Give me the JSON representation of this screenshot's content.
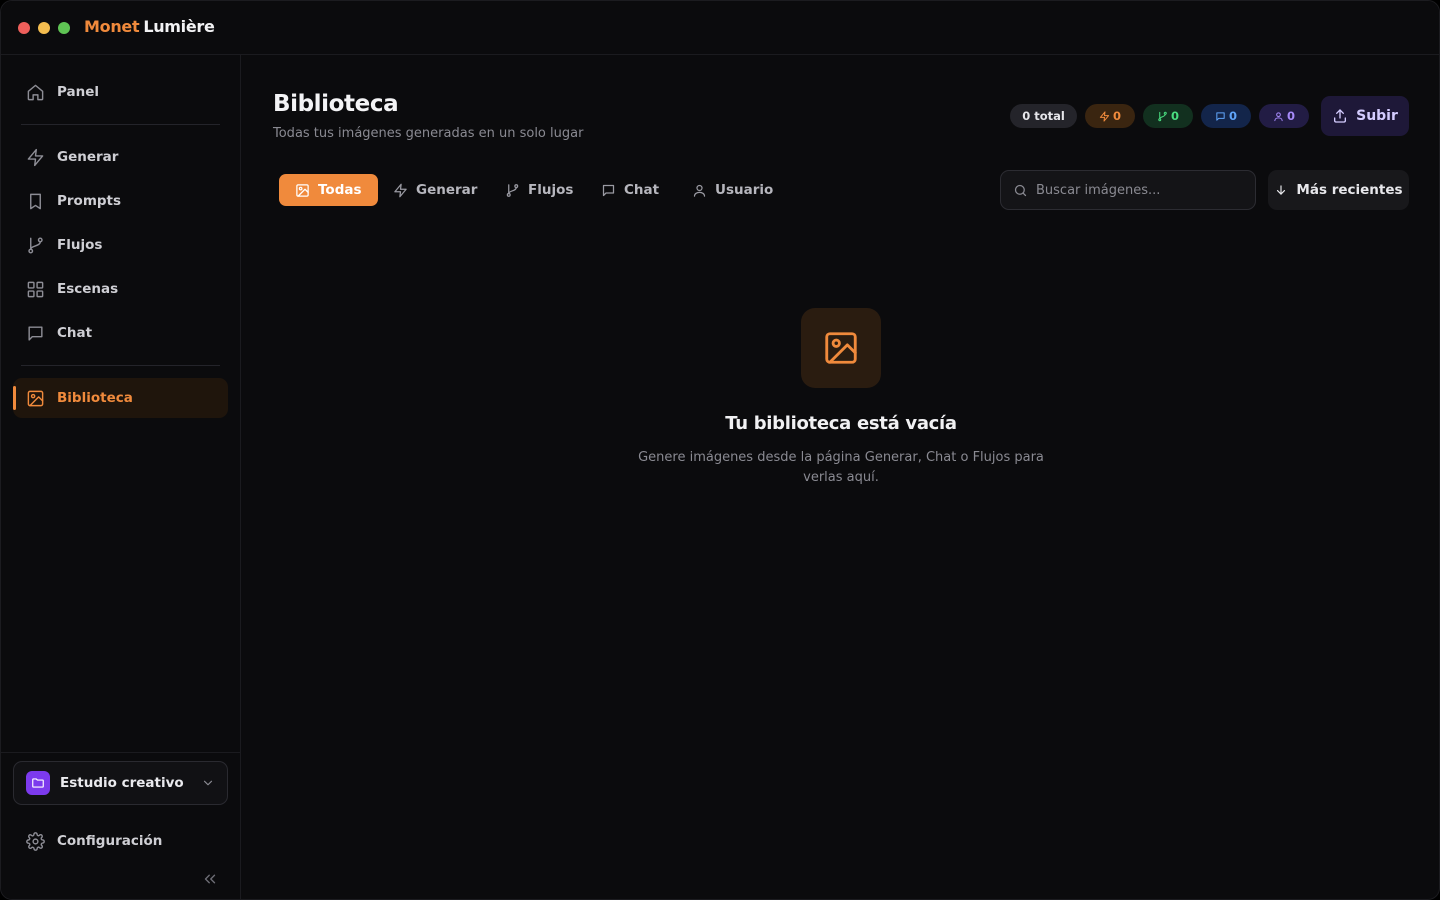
{
  "app": {
    "brand_part1": "Monet",
    "brand_part2": "Lumière"
  },
  "sidebar": {
    "items": [
      {
        "label": "Panel",
        "icon": "home-icon"
      },
      {
        "label": "Generar",
        "icon": "zap-icon"
      },
      {
        "label": "Prompts",
        "icon": "bookmark-icon"
      },
      {
        "label": "Flujos",
        "icon": "git-branch-icon"
      },
      {
        "label": "Escenas",
        "icon": "grid-icon"
      },
      {
        "label": "Chat",
        "icon": "message-icon"
      },
      {
        "label": "Biblioteca",
        "icon": "image-icon",
        "active": true
      }
    ],
    "workspace": {
      "label": "Estudio creativo",
      "icon": "folder-icon"
    },
    "settings_label": "Configuración"
  },
  "header": {
    "title": "Biblioteca",
    "subtitle": "Todas tus imágenes generadas en un solo lugar",
    "badges": {
      "total": "0 total",
      "generar": "0",
      "flujos": "0",
      "chat": "0",
      "usuario": "0"
    },
    "upload_label": "Subir"
  },
  "filters": {
    "tabs": [
      {
        "label": "Todas",
        "icon": "image-icon",
        "active": true
      },
      {
        "label": "Generar",
        "icon": "zap-icon"
      },
      {
        "label": "Flujos",
        "icon": "git-branch-icon"
      },
      {
        "label": "Chat",
        "icon": "message-icon"
      },
      {
        "label": "Usuario",
        "icon": "user-icon"
      }
    ],
    "search_placeholder": "Buscar imágenes...",
    "sort_label": "Más recientes"
  },
  "empty_state": {
    "title": "Tu biblioteca está vacía",
    "description": "Genere imágenes desde la página Generar, Chat o Flujos para verlas aquí."
  },
  "colors": {
    "accent": "#f08a3c",
    "background": "#0b0b0d",
    "workspace": "#7c3aed",
    "flujos_badge": "#4ade80",
    "chat_badge": "#60a5fa",
    "usuario_badge": "#a78bfa"
  }
}
